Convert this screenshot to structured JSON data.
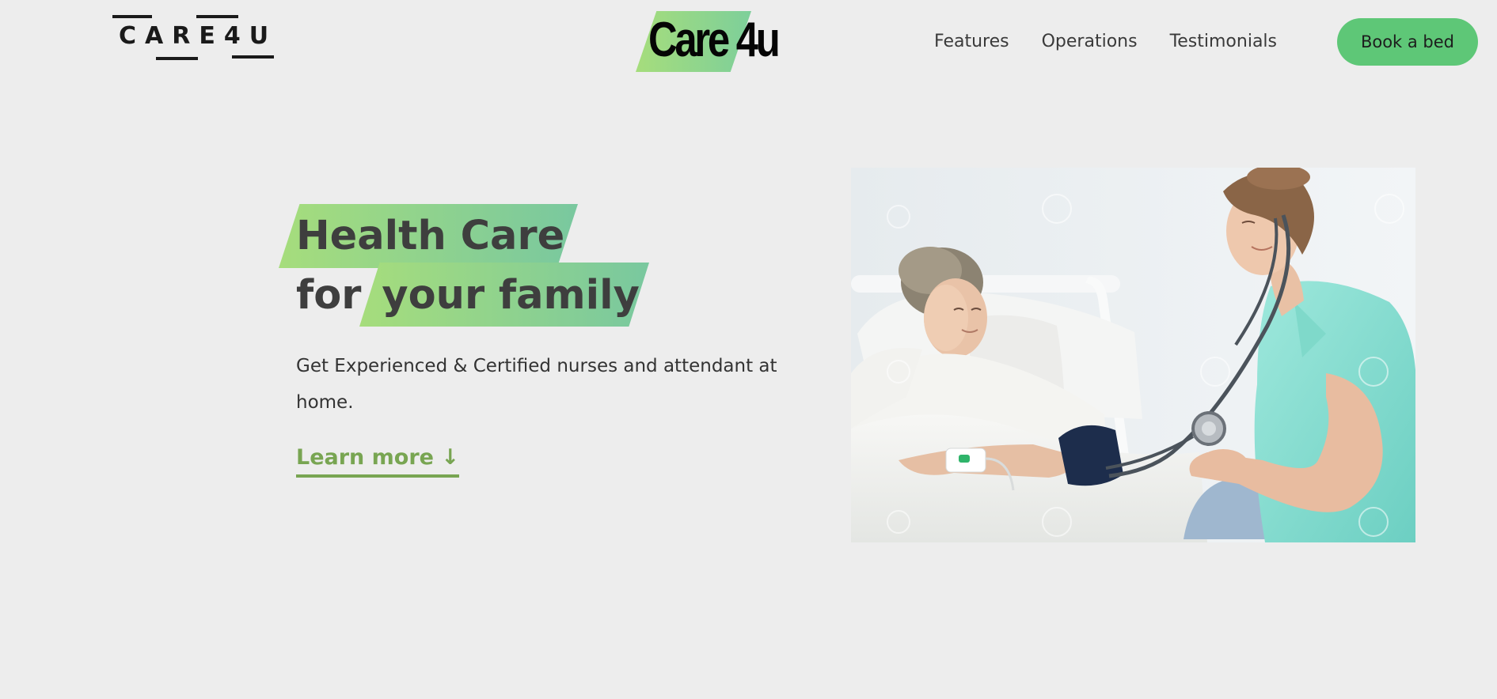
{
  "header": {
    "logo_left_text": "CARE4U",
    "logo_center_text": "Care 4u",
    "nav_items": [
      {
        "label": "Features"
      },
      {
        "label": "Operations"
      },
      {
        "label": "Testimonials"
      }
    ],
    "cta_label": "Book a bed"
  },
  "hero": {
    "title_part1": "Health Care",
    "title_part2": "for",
    "title_part3": "your family",
    "subtitle": "Get Experienced & Certified nurses and attendant at home.",
    "learn_more_label": "Learn more ↓"
  },
  "colors": {
    "background": "#ededed",
    "accent_green": "#5ec777",
    "highlight_gradient_start": "#a6dd7c",
    "highlight_gradient_end": "#79c89f",
    "link_green": "#78a552",
    "text": "#3e3e3e"
  },
  "icons": {
    "learn_more_arrow": "arrow-down-icon"
  }
}
